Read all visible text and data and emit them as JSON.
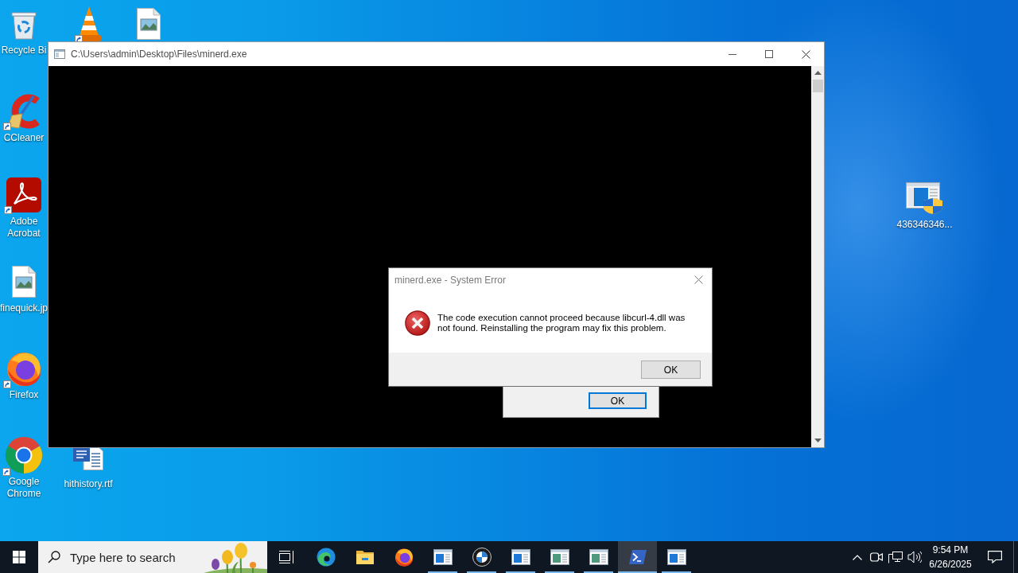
{
  "desktop": {
    "icons": [
      {
        "kind": "recycle-bin",
        "label": "Recycle Bi",
        "shortcut": false
      },
      {
        "kind": "cone",
        "shortcut": true
      },
      {
        "kind": "image-file",
        "shortcut": false
      },
      {
        "kind": "cleaner",
        "label": "CCleaner",
        "shortcut": true
      },
      {
        "kind": "pdf-reader",
        "label": "Adobe Acrobat",
        "shortcut": true
      },
      {
        "kind": "image-file",
        "label": "finequick.jp",
        "shortcut": false
      },
      {
        "kind": "firefox",
        "label": "Firefox",
        "shortcut": true
      },
      {
        "kind": "chrome",
        "label": "Google Chrome",
        "shortcut": true
      },
      {
        "kind": "document",
        "label": "hithistory.rtf",
        "shortcut": false
      },
      {
        "kind": "installer",
        "label": "436346346...",
        "shortcut": false
      }
    ]
  },
  "console_window": {
    "title": "C:\\Users\\admin\\Desktop\\Files\\minerd.exe"
  },
  "error_dialog": {
    "title": "minerd.exe - System Error",
    "message": "The code execution cannot proceed because libcurl-4.dll was not found. Reinstalling the program may fix this problem.",
    "button": {
      "label": "OK",
      "focused": false
    }
  },
  "background_dialog": {
    "button": {
      "label": "OK",
      "focused": true
    }
  },
  "taskbar": {
    "search": {
      "placeholder": "Type here to search"
    },
    "apps": [
      {
        "kind": "task-view",
        "running": false,
        "selected": false
      },
      {
        "kind": "edge",
        "running": false,
        "selected": false
      },
      {
        "kind": "file-explorer",
        "running": false,
        "selected": false
      },
      {
        "kind": "firefox",
        "running": false,
        "selected": false
      },
      {
        "kind": "app-window",
        "running": true,
        "selected": false
      },
      {
        "kind": "round-emblem",
        "running": true,
        "selected": false
      },
      {
        "kind": "app-window",
        "running": true,
        "selected": false
      },
      {
        "kind": "image-window",
        "running": true,
        "selected": false
      },
      {
        "kind": "image-window",
        "running": true,
        "selected": false
      },
      {
        "kind": "powershell",
        "running": true,
        "selected": true
      },
      {
        "kind": "app-window",
        "running": true,
        "selected": false
      }
    ],
    "clock": {
      "time": "9:54 PM",
      "date": "6/26/2025"
    }
  }
}
